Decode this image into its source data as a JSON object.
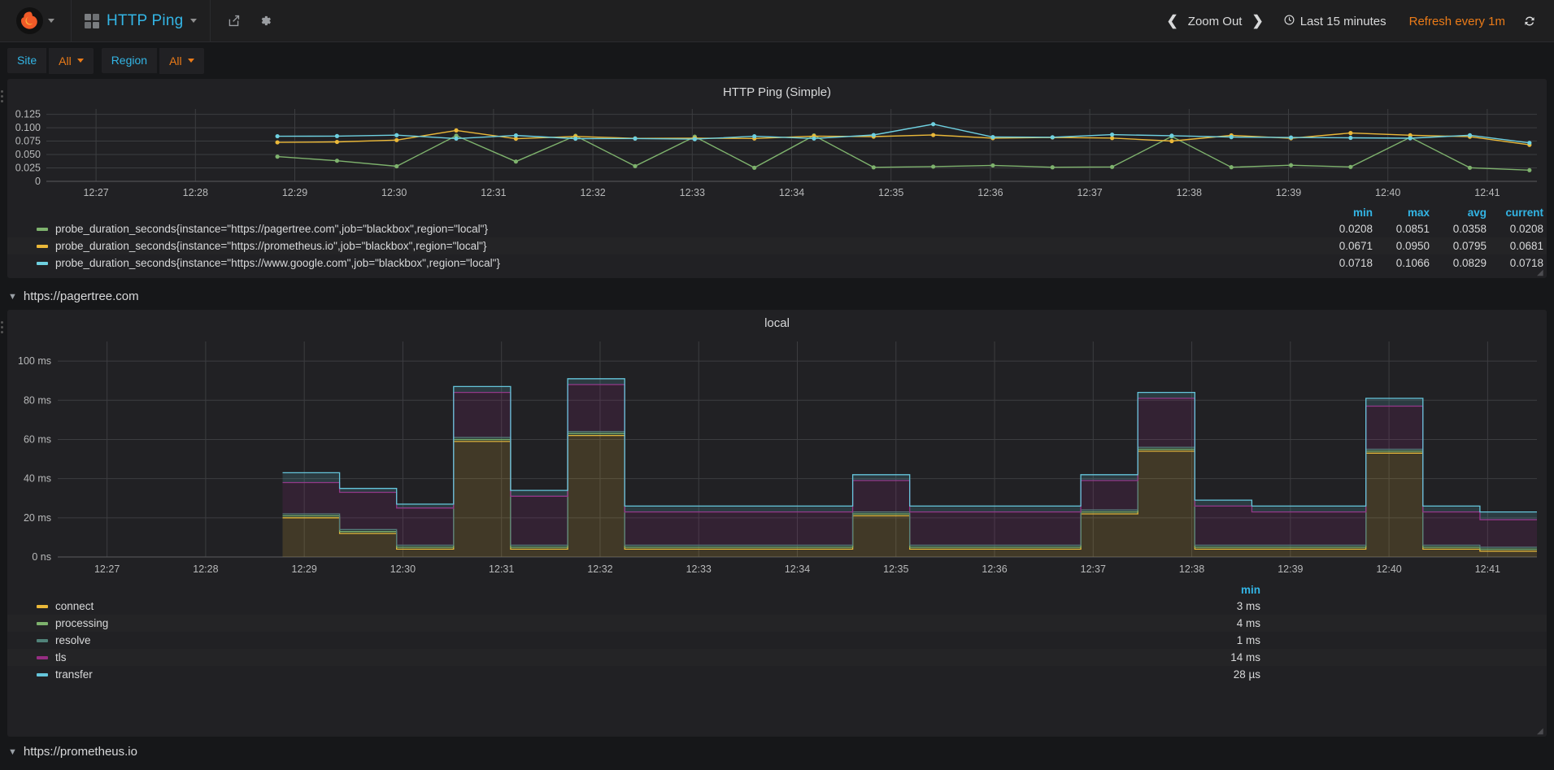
{
  "navbar": {
    "logo_icon": "grafana-logo-icon",
    "logo_caret_icon": "chevron-down-icon",
    "dashboard_icon": "dashboard-grid-icon",
    "dashboard_title": "HTTP Ping",
    "dashboard_caret_icon": "chevron-down-icon",
    "share_icon": "share-icon",
    "settings_icon": "gear-icon",
    "zoom_out_prev_icon": "chevron-left-icon",
    "zoom_out_label": "Zoom Out",
    "zoom_out_next_icon": "chevron-right-icon",
    "clock_icon": "clock-icon",
    "time_range": "Last 15 minutes",
    "refresh_interval": "Refresh every 1m",
    "refresh_icon": "refresh-icon"
  },
  "submenu": {
    "variables": [
      {
        "label": "Site",
        "value": "All",
        "caret_icon": "chevron-down-icon"
      },
      {
        "label": "Region",
        "value": "All",
        "caret_icon": "chevron-down-icon"
      }
    ]
  },
  "panel1": {
    "title": "HTTP Ping (Simple)",
    "drag_handle_icon": "drag-handle-icon",
    "legend_headers": [
      "min",
      "max",
      "avg",
      "current"
    ],
    "series": [
      {
        "label": "probe_duration_seconds{instance=\"https://pagertree.com\",job=\"blackbox\",region=\"local\"}",
        "color": "#7eb26d",
        "min": "0.0208",
        "max": "0.0851",
        "avg": "0.0358",
        "current": "0.0208"
      },
      {
        "label": "probe_duration_seconds{instance=\"https://prometheus.io\",job=\"blackbox\",region=\"local\"}",
        "color": "#eab839",
        "min": "0.0671",
        "max": "0.0950",
        "avg": "0.0795",
        "current": "0.0681"
      },
      {
        "label": "probe_duration_seconds{instance=\"https://www.google.com\",job=\"blackbox\",region=\"local\"}",
        "color": "#6ed0e0",
        "min": "0.0718",
        "max": "0.1066",
        "avg": "0.0829",
        "current": "0.0718"
      }
    ]
  },
  "row1": {
    "chevron_icon": "chevron-down-icon",
    "title": "https://pagertree.com"
  },
  "panel2": {
    "title": "local",
    "drag_handle_icon": "drag-handle-icon",
    "legend_headers": [
      "min"
    ],
    "series": [
      {
        "label": "connect",
        "color": "#eab839",
        "min": "3 ms"
      },
      {
        "label": "processing",
        "color": "#7eb26d",
        "min": "4 ms"
      },
      {
        "label": "resolve",
        "color": "#508279",
        "min": "1 ms"
      },
      {
        "label": "tls",
        "color": "#962d82",
        "min": "14 ms"
      },
      {
        "label": "transfer",
        "color": "#65c5db",
        "min": "28 µs"
      }
    ]
  },
  "row2": {
    "chevron_icon": "chevron-down-icon",
    "title": "https://prometheus.io"
  },
  "chart_data": [
    {
      "type": "line",
      "title": "HTTP Ping (Simple)",
      "xlabel": "",
      "ylabel": "",
      "ylim": [
        0,
        0.135
      ],
      "yticks": [
        0,
        0.025,
        0.05,
        0.075,
        0.1,
        0.125
      ],
      "ytick_labels": [
        "0",
        "0.025",
        "0.050",
        "0.075",
        "0.100",
        "0.125"
      ],
      "xticks": [
        "12:27",
        "12:28",
        "12:29",
        "12:30",
        "12:31",
        "12:32",
        "12:33",
        "12:34",
        "12:35",
        "12:36",
        "12:37",
        "12:38",
        "12:39",
        "12:40",
        "12:41"
      ],
      "grid": true,
      "legend": "bottom-table",
      "x": [
        12.47,
        12.48,
        12.49,
        12.5,
        12.51,
        12.52,
        12.53,
        12.54,
        12.55,
        12.56,
        12.57,
        12.58,
        12.59,
        12.6,
        12.61,
        12.62,
        12.63,
        12.64,
        12.65,
        12.66,
        12.67,
        12.68
      ],
      "series": [
        {
          "name": "probe_duration_seconds{instance=\"https://pagertree.com\",job=\"blackbox\",region=\"local\"}",
          "color": "#7eb26d",
          "values": [
            0.0461,
            0.0384,
            0.0281,
            0.0851,
            0.0369,
            0.0849,
            0.0283,
            0.0833,
            0.0253,
            0.0855,
            0.0261,
            0.0274,
            0.0297,
            0.0262,
            0.0268,
            0.0837,
            0.0263,
            0.0301,
            0.0268,
            0.0821,
            0.0253,
            0.0208
          ]
        },
        {
          "name": "probe_duration_seconds{instance=\"https://prometheus.io\",job=\"blackbox\",region=\"local\"}",
          "color": "#eab839",
          "values": [
            0.0727,
            0.0735,
            0.0769,
            0.095,
            0.0795,
            0.0838,
            0.0801,
            0.0806,
            0.0799,
            0.0843,
            0.0834,
            0.0864,
            0.0806,
            0.0819,
            0.0807,
            0.0751,
            0.0857,
            0.0803,
            0.0901,
            0.086,
            0.0832,
            0.0681
          ]
        },
        {
          "name": "probe_duration_seconds{instance=\"https://www.google.com\",job=\"blackbox\",region=\"local\"}",
          "color": "#6ed0e0",
          "values": [
            0.0841,
            0.0844,
            0.0861,
            0.0798,
            0.0856,
            0.0796,
            0.0798,
            0.0787,
            0.084,
            0.0799,
            0.0864,
            0.1066,
            0.0826,
            0.0822,
            0.0871,
            0.0851,
            0.0825,
            0.0817,
            0.0811,
            0.0804,
            0.086,
            0.0718
          ]
        }
      ]
    },
    {
      "type": "area",
      "title": "local",
      "stacked": true,
      "xlabel": "",
      "ylabel": "",
      "ylim": [
        0,
        110
      ],
      "yticks": [
        0,
        20,
        40,
        60,
        80,
        100
      ],
      "ytick_labels": [
        "0 ns",
        "20 ms",
        "40 ms",
        "60 ms",
        "80 ms",
        "100 ms"
      ],
      "xticks": [
        "12:27",
        "12:28",
        "12:29",
        "12:30",
        "12:31",
        "12:32",
        "12:33",
        "12:34",
        "12:35",
        "12:36",
        "12:37",
        "12:38",
        "12:39",
        "12:40",
        "12:41"
      ],
      "grid": true,
      "legend": "bottom-table",
      "unit": "ms",
      "x": [
        12.475,
        12.487,
        12.497,
        12.507,
        12.517,
        12.527,
        12.537,
        12.547,
        12.557,
        12.567,
        12.577,
        12.587,
        12.597,
        12.607,
        12.617,
        12.627,
        12.637,
        12.647,
        12.657,
        12.667,
        12.677,
        12.687
      ],
      "series": [
        {
          "name": "connect",
          "color": "#eab839",
          "values": [
            20,
            12,
            4,
            59,
            4,
            62,
            4,
            4,
            4,
            4,
            21,
            4,
            4,
            4,
            22,
            54,
            4,
            4,
            4,
            53,
            4,
            3
          ]
        },
        {
          "name": "processing",
          "color": "#7eb26d",
          "values": [
            1,
            1,
            1,
            1,
            1,
            1,
            1,
            1,
            1,
            1,
            1,
            1,
            1,
            1,
            1,
            1,
            1,
            1,
            1,
            1,
            1,
            1
          ]
        },
        {
          "name": "resolve",
          "color": "#508279",
          "values": [
            1,
            1,
            1,
            1,
            1,
            1,
            1,
            1,
            1,
            1,
            1,
            1,
            1,
            1,
            1,
            1,
            1,
            1,
            1,
            1,
            1,
            1
          ]
        },
        {
          "name": "tls",
          "color": "#962d82",
          "values": [
            16,
            19,
            19,
            23,
            25,
            24,
            17,
            17,
            17,
            17,
            16,
            17,
            17,
            17,
            15,
            25,
            20,
            17,
            17,
            22,
            17,
            14
          ]
        },
        {
          "name": "transfer",
          "color": "#65c5db",
          "values": [
            5,
            2,
            2,
            3,
            3,
            3,
            3,
            3,
            3,
            3,
            3,
            3,
            3,
            3,
            3,
            3,
            3,
            3,
            3,
            4,
            3,
            4
          ]
        }
      ]
    }
  ]
}
